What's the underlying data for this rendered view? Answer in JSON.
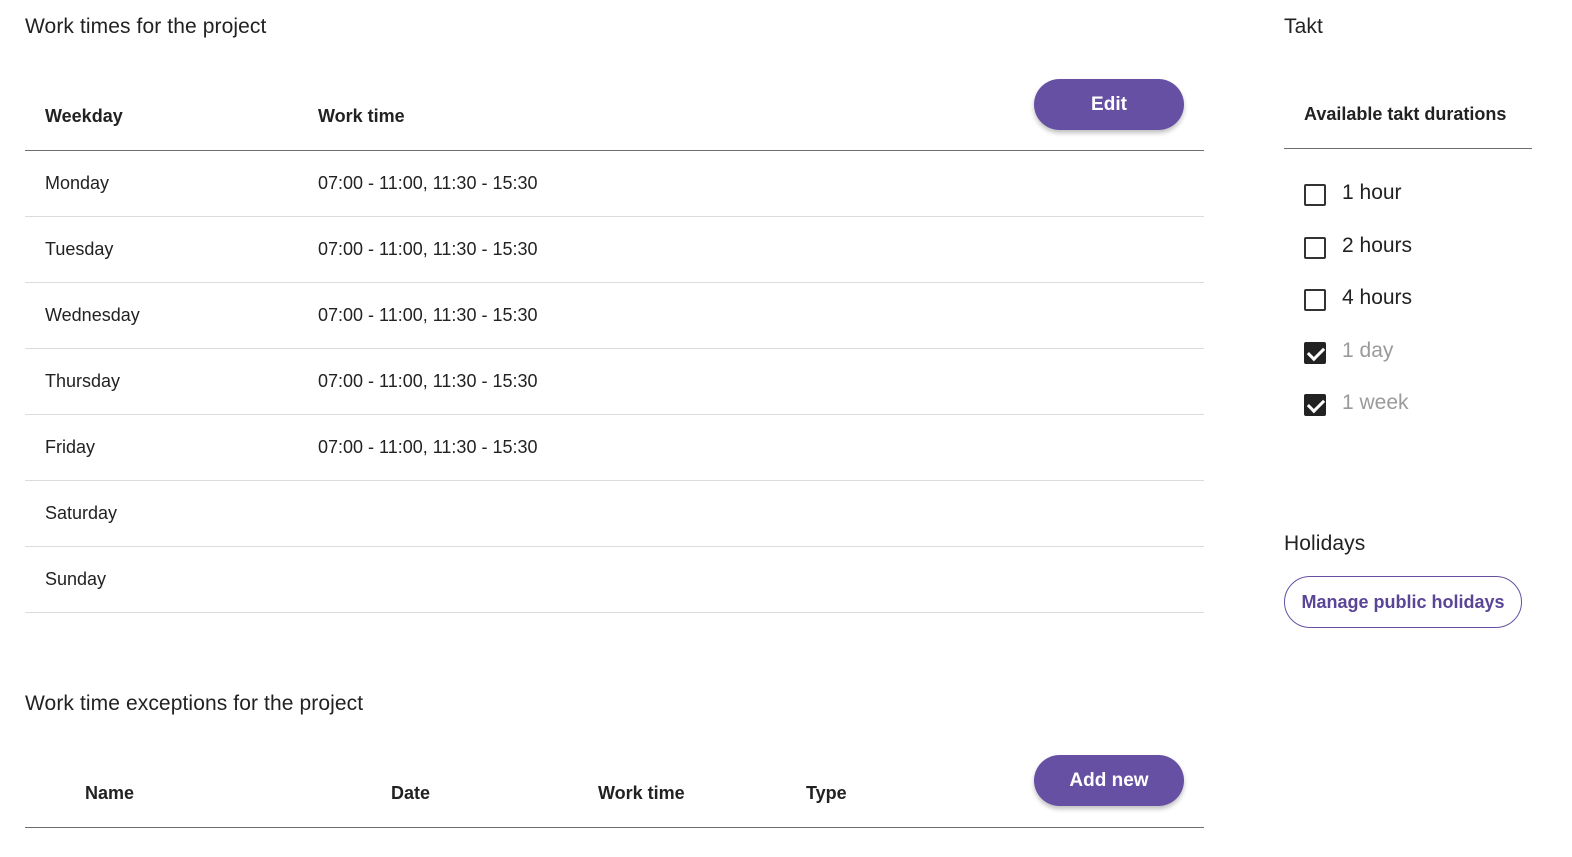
{
  "work_times": {
    "title": "Work times for the project",
    "columns": {
      "weekday": "Weekday",
      "work_time": "Work time"
    },
    "edit_label": "Edit",
    "rows": [
      {
        "day": "Monday",
        "time": "07:00 - 11:00, 11:30 - 15:30"
      },
      {
        "day": "Tuesday",
        "time": "07:00 - 11:00, 11:30 - 15:30"
      },
      {
        "day": "Wednesday",
        "time": "07:00 - 11:00, 11:30 - 15:30"
      },
      {
        "day": "Thursday",
        "time": "07:00 - 11:00, 11:30 - 15:30"
      },
      {
        "day": "Friday",
        "time": "07:00 - 11:00, 11:30 - 15:30"
      },
      {
        "day": "Saturday",
        "time": ""
      },
      {
        "day": "Sunday",
        "time": ""
      }
    ]
  },
  "exceptions": {
    "title": "Work time exceptions for the project",
    "columns": {
      "name": "Name",
      "date": "Date",
      "work_time": "Work time",
      "type": "Type"
    },
    "add_label": "Add new"
  },
  "takt": {
    "title": "Takt",
    "header": "Available takt durations",
    "items": [
      {
        "label": "1 hour",
        "checked": false,
        "disabled": false
      },
      {
        "label": "2 hours",
        "checked": false,
        "disabled": false
      },
      {
        "label": "4 hours",
        "checked": false,
        "disabled": false
      },
      {
        "label": "1 day",
        "checked": true,
        "disabled": true
      },
      {
        "label": "1 week",
        "checked": true,
        "disabled": true
      }
    ]
  },
  "holidays": {
    "title": "Holidays",
    "manage_label": "Manage public holidays"
  },
  "colors": {
    "accent": "#6650a4",
    "text": "#222222",
    "disabled_text": "#9a9a9a"
  }
}
